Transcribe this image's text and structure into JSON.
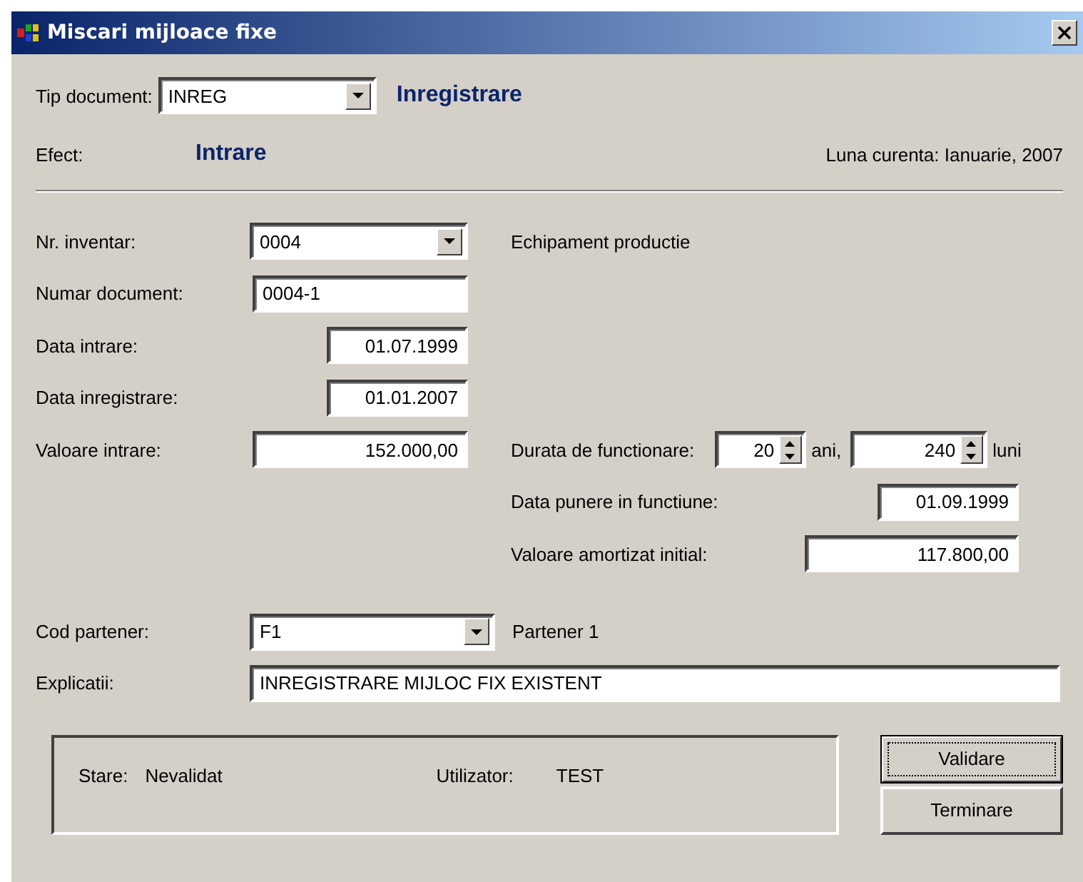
{
  "window": {
    "title": "Miscari mijloace fixe"
  },
  "document_type": {
    "label": "Tip document:",
    "value": "INREG",
    "description": "Inregistrare"
  },
  "effect": {
    "label": "Efect:",
    "value": "Intrare"
  },
  "current_month": "Luna curenta: Ianuarie, 2007",
  "fields": [
    {
      "kind": "combo",
      "label": "Nr. inventar:",
      "value": "0004"
    },
    {
      "kind": "text",
      "label": "Numar document:",
      "value": "0004-1"
    },
    {
      "kind": "date",
      "label": "Data intrare:",
      "value": "01.07.1999"
    },
    {
      "kind": "date",
      "label": "Data inregistrare:",
      "value": "01.01.2007"
    },
    {
      "kind": "amount",
      "label": "Valoare intrare:",
      "value": "152.000,00"
    }
  ],
  "asset_name": "Echipament productie",
  "duration": {
    "label": "Durata de functionare:",
    "years": "20",
    "years_unit": "ani,",
    "months": "240",
    "months_unit": "luni"
  },
  "commissioning_date": {
    "label": "Data punere in functiune:",
    "value": "01.09.1999"
  },
  "initial_depreciation": {
    "label": "Valoare amortizat initial:",
    "value": "117.800,00"
  },
  "partner": {
    "label": "Cod partener:",
    "value": "F1",
    "name": "Partener 1"
  },
  "explanation": {
    "label": "Explicatii:",
    "value": "INREGISTRARE MIJLOC FIX EXISTENT"
  },
  "status": {
    "state_label": "Stare:",
    "state": "Nevalidat",
    "user_label": "Utilizator:",
    "user": "TEST"
  },
  "buttons": [
    {
      "label": "Validare",
      "focused": true
    },
    {
      "label": "Terminare",
      "focused": false
    }
  ]
}
